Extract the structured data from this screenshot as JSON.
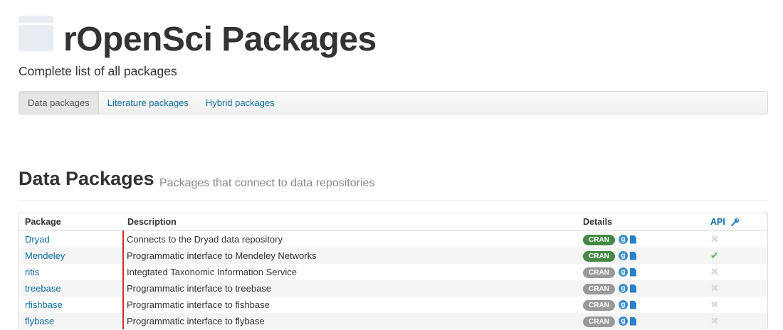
{
  "header": {
    "title": "rOpenSci Packages",
    "subtitle": "Complete list of all packages",
    "logo_icon": "box-icon"
  },
  "tabs": [
    {
      "label": "Data packages",
      "active": true
    },
    {
      "label": "Literature packages",
      "active": false
    },
    {
      "label": "Hybrid packages",
      "active": false
    }
  ],
  "section": {
    "title": "Data Packages",
    "subtitle": "Packages that connect to data repositories"
  },
  "table": {
    "headers": {
      "package": "Package",
      "description": "Description",
      "details": "Details",
      "api": "API"
    },
    "rows": [
      {
        "package": "Dryad",
        "description": "Connects to the Dryad data repository",
        "badge": "CRAN",
        "badge_status": "green",
        "api_key": false
      },
      {
        "package": "Mendeley",
        "description": "Programmatic interface to Mendeley Networks",
        "badge": "CRAN",
        "badge_status": "green",
        "api_key": true
      },
      {
        "package": "ritis",
        "description": "Integtated Taxonomic Information Service",
        "badge": "CRAN",
        "badge_status": "grey",
        "api_key": false
      },
      {
        "package": "treebase",
        "description": "Programmatic interface to treebase",
        "badge": "CRAN",
        "badge_status": "grey",
        "api_key": false
      },
      {
        "package": "rfishbase",
        "description": "Programmatic interface to fishbase",
        "badge": "CRAN",
        "badge_status": "grey",
        "api_key": false
      },
      {
        "package": "flybase",
        "description": "Programmatic interface to flybase",
        "badge": "CRAN",
        "badge_status": "grey",
        "api_key": false
      }
    ]
  },
  "icons": {
    "github": "github-icon",
    "docs": "document-icon",
    "api_header": "wrench-icon",
    "api_yes": "check-icon",
    "api_no": "cross-icon"
  },
  "colors": {
    "link": "#0d6ea3",
    "badge_green": "#468847",
    "badge_grey": "#999999",
    "check": "#5cb85c",
    "description_rule": "#c9302c"
  }
}
